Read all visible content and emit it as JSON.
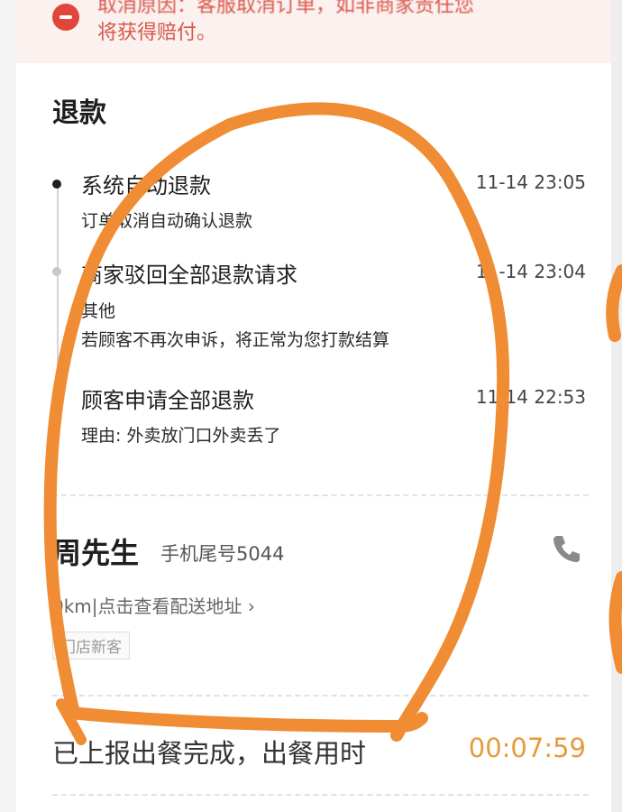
{
  "banner": {
    "line1": "取消原因：客服取消订单，如非商家责任您",
    "line2": "将获得赔付。",
    "icon": "minus-circle-icon"
  },
  "refund": {
    "title": "退款",
    "events": [
      {
        "title": "系统自动退款",
        "time": "11-14 23:05",
        "lines": [
          "订单取消自动确认退款"
        ]
      },
      {
        "title": "商家驳回全部退款请求",
        "time": "11-14 23:04",
        "lines": [
          "其他",
          "若顾客不再次申诉，将正常为您打款结算"
        ]
      },
      {
        "title": "顾客申请全部退款",
        "time": "11-14 22:53",
        "lines": [
          "理由: 外卖放门口外卖丢了"
        ]
      }
    ]
  },
  "customer": {
    "name": "周先生",
    "phone_label": "手机尾号5044",
    "address_link": "0km|点击查看配送地址 ›",
    "tag": "门店新客",
    "phone_icon": "phone-icon"
  },
  "meal": {
    "label": "已上报出餐完成，出餐用时",
    "time": "00:07:59"
  },
  "colors": {
    "accent_orange": "#f08c33",
    "banner_red": "#d9574b",
    "timer_orange": "#e79a3e"
  }
}
